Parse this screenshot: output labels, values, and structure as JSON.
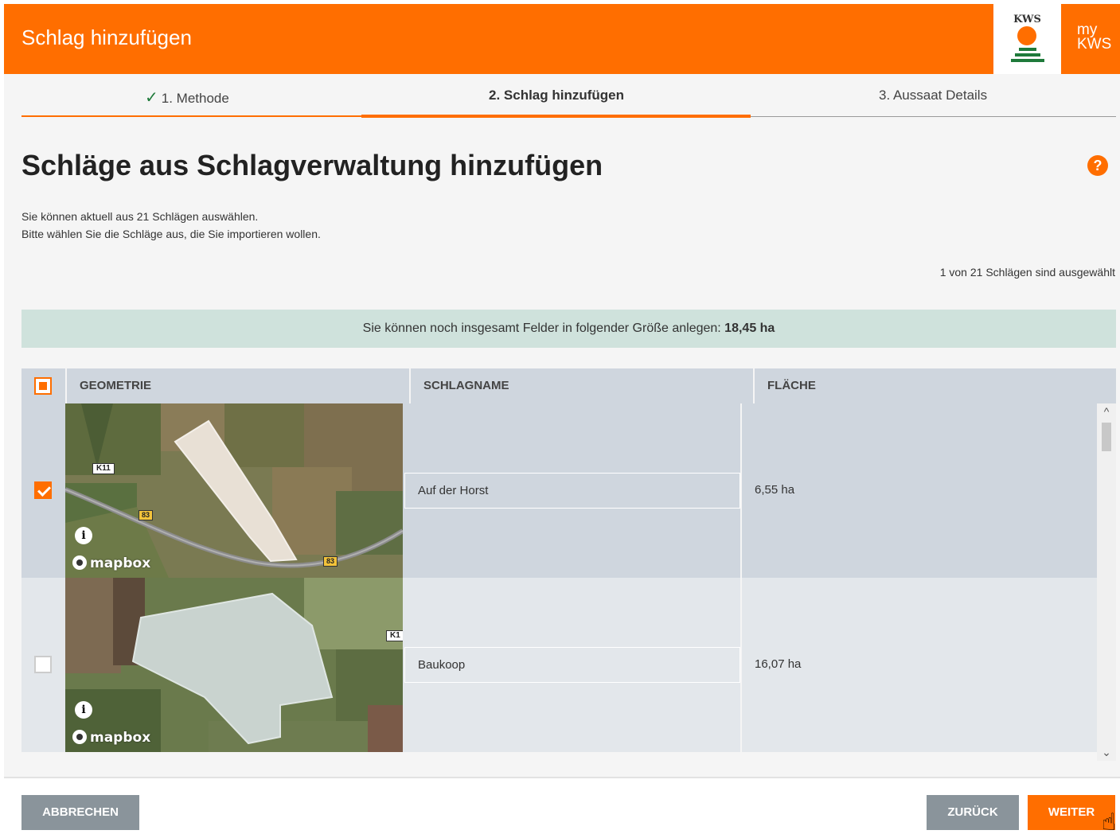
{
  "header": {
    "title": "Schlag hinzufügen",
    "logo_text": "KWS",
    "my_label": "my",
    "kws_label": "KWS"
  },
  "steps": [
    {
      "label": "1. Methode",
      "state": "done"
    },
    {
      "label": "2. Schlag hinzufügen",
      "state": "active"
    },
    {
      "label": "3. Aussaat Details",
      "state": "pending"
    }
  ],
  "page": {
    "heading": "Schläge aus Schlagverwaltung hinzufügen",
    "help_symbol": "?",
    "desc_line1": "Sie können aktuell aus 21 Schlägen auswählen.",
    "desc_line2": "Bitte wählen Sie die Schläge aus, die Sie importieren wollen.",
    "selection_count": "1 von 21 Schlägen sind ausgewählt"
  },
  "info_bar": {
    "text": "Sie können noch insgesamt Felder in folgender Größe anlegen: ",
    "value": "18,45 ha"
  },
  "table": {
    "columns": [
      "GEOMETRIE",
      "SCHLAGNAME",
      "FLÄCHE"
    ],
    "rows": [
      {
        "checked": true,
        "name": "Auf der Horst",
        "area": "6,55 ha",
        "roads": [
          "K11",
          "83",
          "83"
        ]
      },
      {
        "checked": false,
        "name": "Baukoop",
        "area": "16,07 ha",
        "roads": [
          "K1"
        ]
      }
    ],
    "map_attribution": "mapbox",
    "info_symbol": "i",
    "scroll_up": "^",
    "scroll_down": "⌄"
  },
  "footer": {
    "cancel": "ABBRECHEN",
    "back": "ZURÜCK",
    "next": "WEITER"
  },
  "colors": {
    "brand_orange": "#ff6e00",
    "kws_green": "#1e7a3a",
    "info_bar_bg": "#cfe2dc",
    "table_header_bg": "#cfd6de"
  }
}
